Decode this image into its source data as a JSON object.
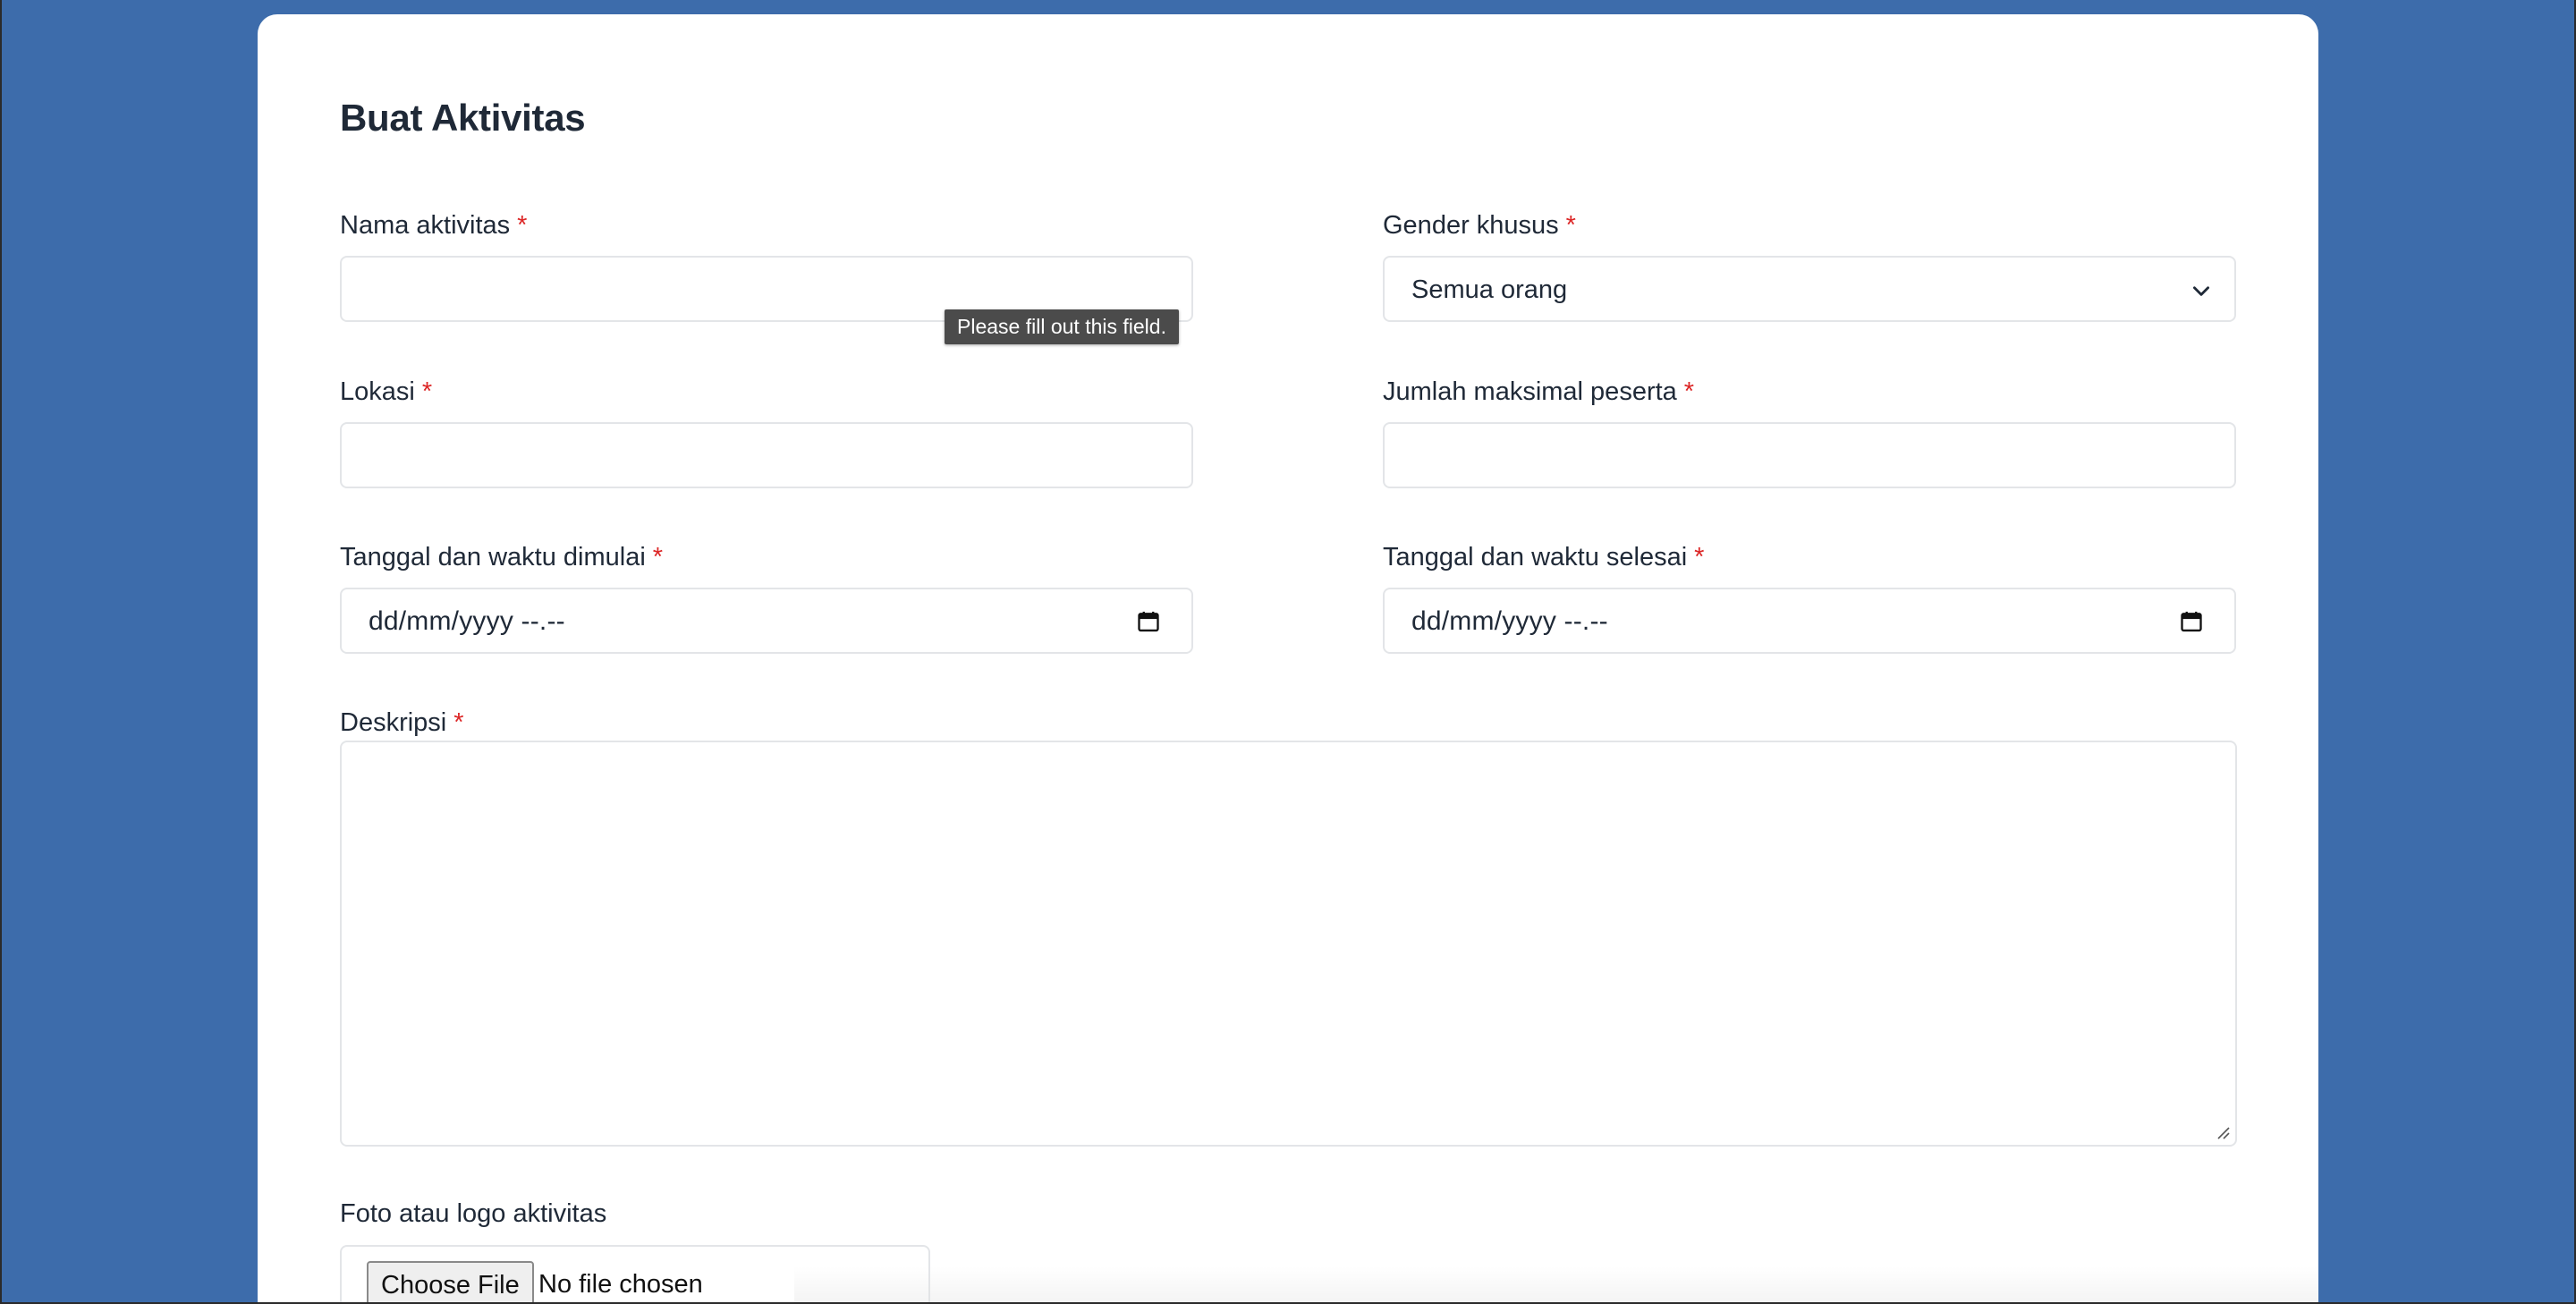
{
  "form": {
    "title": "Buat Aktivitas",
    "required_marker": "*",
    "nama": {
      "label": "Nama aktivitas",
      "value": "",
      "tooltip": "Please fill out this field."
    },
    "gender": {
      "label": "Gender khusus",
      "selected": "Semua orang"
    },
    "lokasi": {
      "label": "Lokasi",
      "value": ""
    },
    "jumlah": {
      "label": "Jumlah maksimal peserta",
      "value": ""
    },
    "mulai": {
      "label": "Tanggal dan waktu dimulai",
      "placeholder": "dd/mm/yyyy --.--"
    },
    "selesai": {
      "label": "Tanggal dan waktu selesai",
      "placeholder": "dd/mm/yyyy --.--"
    },
    "deskripsi": {
      "label": "Deskripsi",
      "value": ""
    },
    "foto": {
      "label": "Foto atau logo aktivitas",
      "button_label": "Choose File",
      "status": "No file chosen"
    }
  },
  "icons": {
    "select": "chevron-down-icon",
    "datetime": "calendar-icon",
    "textarea": "resize-handle-icon"
  },
  "colors": {
    "background": "#3d6cab",
    "card": "#ffffff",
    "required": "#dc2626",
    "tooltip_bg": "#4b4b4b"
  }
}
